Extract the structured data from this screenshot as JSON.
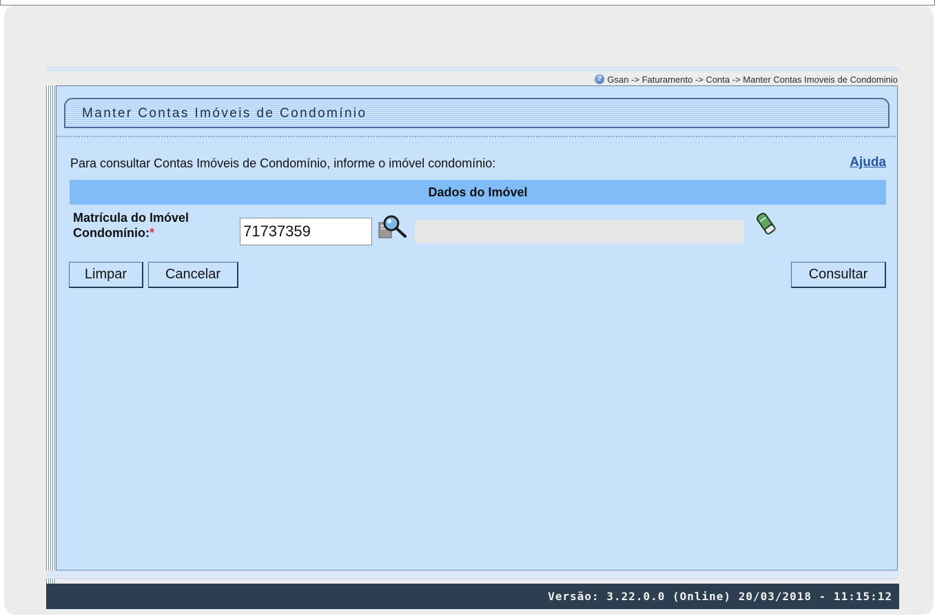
{
  "breadcrumb": {
    "text": "Gsan -> Faturamento -> Conta -> Manter Contas Imoveis de Condominio"
  },
  "page": {
    "title": "Manter Contas Imóveis de Condomínio",
    "instruction": "Para consultar Contas Imóveis de Condomínio, informe o imóvel condomínio:",
    "help_link": "Ajuda"
  },
  "section": {
    "title": "Dados do Imóvel"
  },
  "form": {
    "matricula_label_line1": "Matrícula do Imóvel",
    "matricula_label_line2": "Condomínio:",
    "required_marker": "*",
    "matricula_value": "71737359",
    "description_value": ""
  },
  "buttons": {
    "limpar": "Limpar",
    "cancelar": "Cancelar",
    "consultar": "Consultar"
  },
  "footer": {
    "version_text": "Versão: 3.22.0.0 (Online) 20/03/2018 - 11:15:12"
  },
  "icons": {
    "help": "help-icon",
    "search": "magnifier-search-icon",
    "erase": "eraser-icon"
  },
  "colors": {
    "content_bg": "#c9e2fb",
    "section_header_bg": "#7fbcf8",
    "footer_bg": "#2c3e50",
    "link": "#2455a4",
    "required": "#e0353b"
  }
}
